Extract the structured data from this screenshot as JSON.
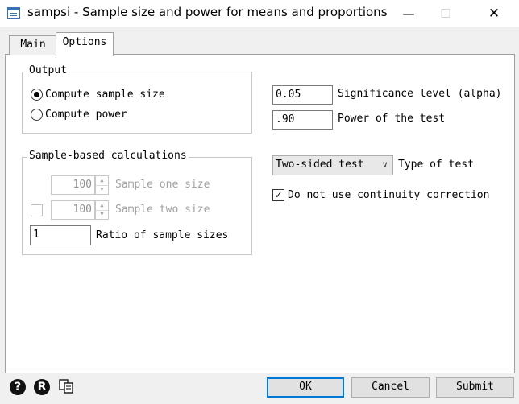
{
  "window": {
    "title": "sampsi - Sample size and power for means and proportions",
    "min_glyph": "—",
    "max_glyph": "☐",
    "close_glyph": "✕"
  },
  "tabs": [
    {
      "label": "Main"
    },
    {
      "label": "Options"
    }
  ],
  "output": {
    "legend": "Output",
    "options": [
      {
        "label": "Compute sample size",
        "selected": true
      },
      {
        "label": "Compute power",
        "selected": false
      }
    ]
  },
  "params": {
    "alpha_value": "0.05",
    "alpha_label": "Significance level (alpha)",
    "power_value": ".90",
    "power_label": "Power of the test",
    "test_type_value": "Two-sided test",
    "test_type_label": "Type of test",
    "continuity_label": "Do not use continuity correction",
    "continuity_checked": "✓"
  },
  "sample_calc": {
    "legend": "Sample-based calculations",
    "one_size_value": "100",
    "one_size_label": "Sample one size",
    "two_size_value": "100",
    "two_size_label": "Sample two size",
    "ratio_value": "1",
    "ratio_label": "Ratio of sample sizes"
  },
  "footer": {
    "help_glyph": "?",
    "reset_glyph": "R",
    "ok_label": "OK",
    "cancel_label": "Cancel",
    "submit_label": "Submit"
  }
}
